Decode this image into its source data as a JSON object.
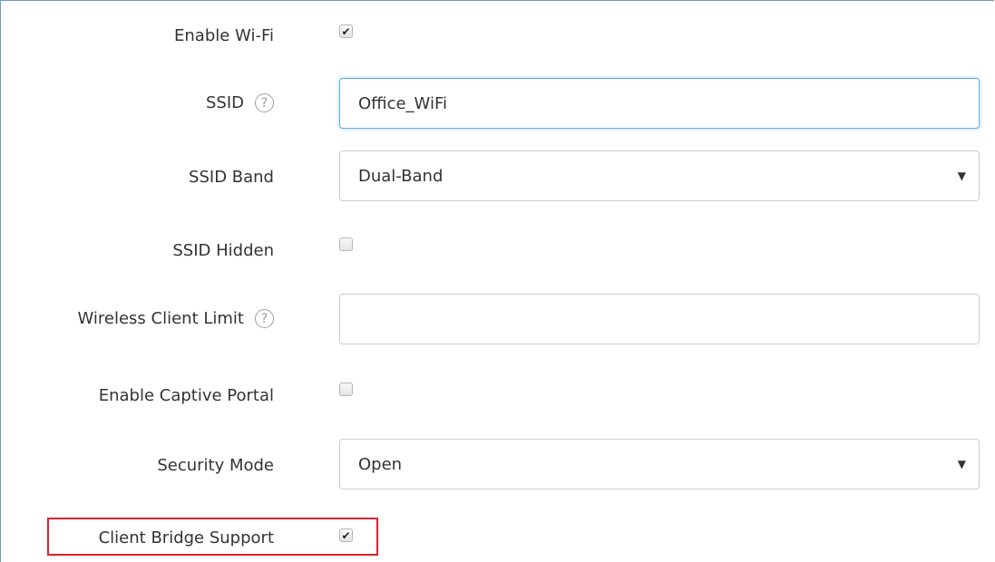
{
  "form": {
    "enable_wifi": {
      "label": "Enable Wi-Fi",
      "checked": true,
      "check_glyph": "✔"
    },
    "ssid": {
      "label": "SSID",
      "help_glyph": "?",
      "value": "Office_WiFi",
      "placeholder": ""
    },
    "ssid_band": {
      "label": "SSID Band",
      "selected": "Dual-Band",
      "caret": "▼"
    },
    "ssid_hidden": {
      "label": "SSID Hidden",
      "checked": false
    },
    "wireless_client_limit": {
      "label": "Wireless Client Limit",
      "help_glyph": "?",
      "value": "",
      "placeholder": ""
    },
    "enable_captive_portal": {
      "label": "Enable Captive Portal",
      "checked": false
    },
    "security_mode": {
      "label": "Security Mode",
      "selected": "Open",
      "caret": "▼"
    },
    "client_bridge_support": {
      "label": "Client Bridge Support",
      "checked": true,
      "check_glyph": "✔"
    }
  },
  "icons": {
    "help": "help-circle-icon",
    "check": "checkmark-icon",
    "caret": "chevron-down-icon"
  },
  "colors": {
    "frame_border": "#6b9bd1",
    "focus_border": "#66afe9",
    "highlight_border": "#d9232d",
    "text": "#333333"
  }
}
